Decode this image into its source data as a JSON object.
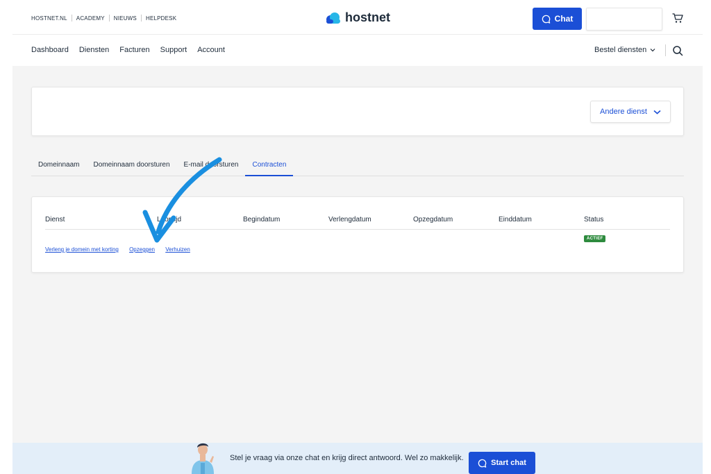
{
  "toplinks": [
    "HOSTNET.NL",
    "ACADEMY",
    "NIEUWS",
    "HELPDESK"
  ],
  "brand": {
    "name": "hostnet",
    "color": "#1b4fd6"
  },
  "header": {
    "chat_label": "Chat"
  },
  "nav": {
    "items": [
      "Dashboard",
      "Diensten",
      "Facturen",
      "Support",
      "Account"
    ],
    "bestel_label": "Bestel diensten"
  },
  "service_select": {
    "label": "Andere dienst"
  },
  "tabs": [
    {
      "label": "Domeinnaam",
      "active": false
    },
    {
      "label": "Domeinnaam doorsturen",
      "active": false
    },
    {
      "label": "E-mail doorsturen",
      "active": false
    },
    {
      "label": "Contracten",
      "active": true
    }
  ],
  "table": {
    "headers": [
      "Dienst",
      "Looptijd",
      "Begindatum",
      "Verlengdatum",
      "Opzegdatum",
      "Einddatum",
      "Status"
    ],
    "status": "ACTIEF",
    "links": [
      "Verleng je domein met korting",
      "Opzeggen",
      "Verhuizen"
    ]
  },
  "footer": {
    "text": "Stel je vraag via onze chat en krijg direct antwoord. Wel zo makkelijk.",
    "button_label": "Start chat"
  },
  "colors": {
    "accent": "#1b4fd6",
    "arrow": "#1a8fe0",
    "status": "#2e8b3e",
    "footer_bg": "#e3eef9"
  }
}
